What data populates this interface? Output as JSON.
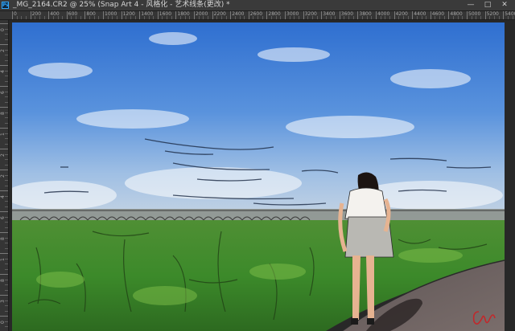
{
  "app": {
    "icon_label": "Ps",
    "icon": "photoshop-icon"
  },
  "document": {
    "title": "_MG_2164.CR2 @ 25% (Snap Art 4 - 风格化 - 艺术线条(更改) *"
  },
  "window_controls": {
    "minimize": "—",
    "restore": "□",
    "close": "✕"
  },
  "rulers": {
    "horizontal": [
      "0",
      "200",
      "400",
      "600",
      "800",
      "1000",
      "1200",
      "1400",
      "1600",
      "1800",
      "2000",
      "2200",
      "2400",
      "2600",
      "2800",
      "3000",
      "3200",
      "3400",
      "3600",
      "3800",
      "4000",
      "4200",
      "4400",
      "4600",
      "4800",
      "5000",
      "5200",
      "5400"
    ],
    "vertical": [
      "0",
      "2",
      "4",
      "6",
      "8",
      "1",
      "2",
      "2",
      "4",
      "6",
      "8",
      "1",
      "8",
      "3",
      "0"
    ]
  },
  "artwork": {
    "description_colors": {
      "sky": "#3b78d8",
      "grass": "#3f8a2e",
      "path": "#6d6262"
    },
    "signature": "Ruby"
  }
}
